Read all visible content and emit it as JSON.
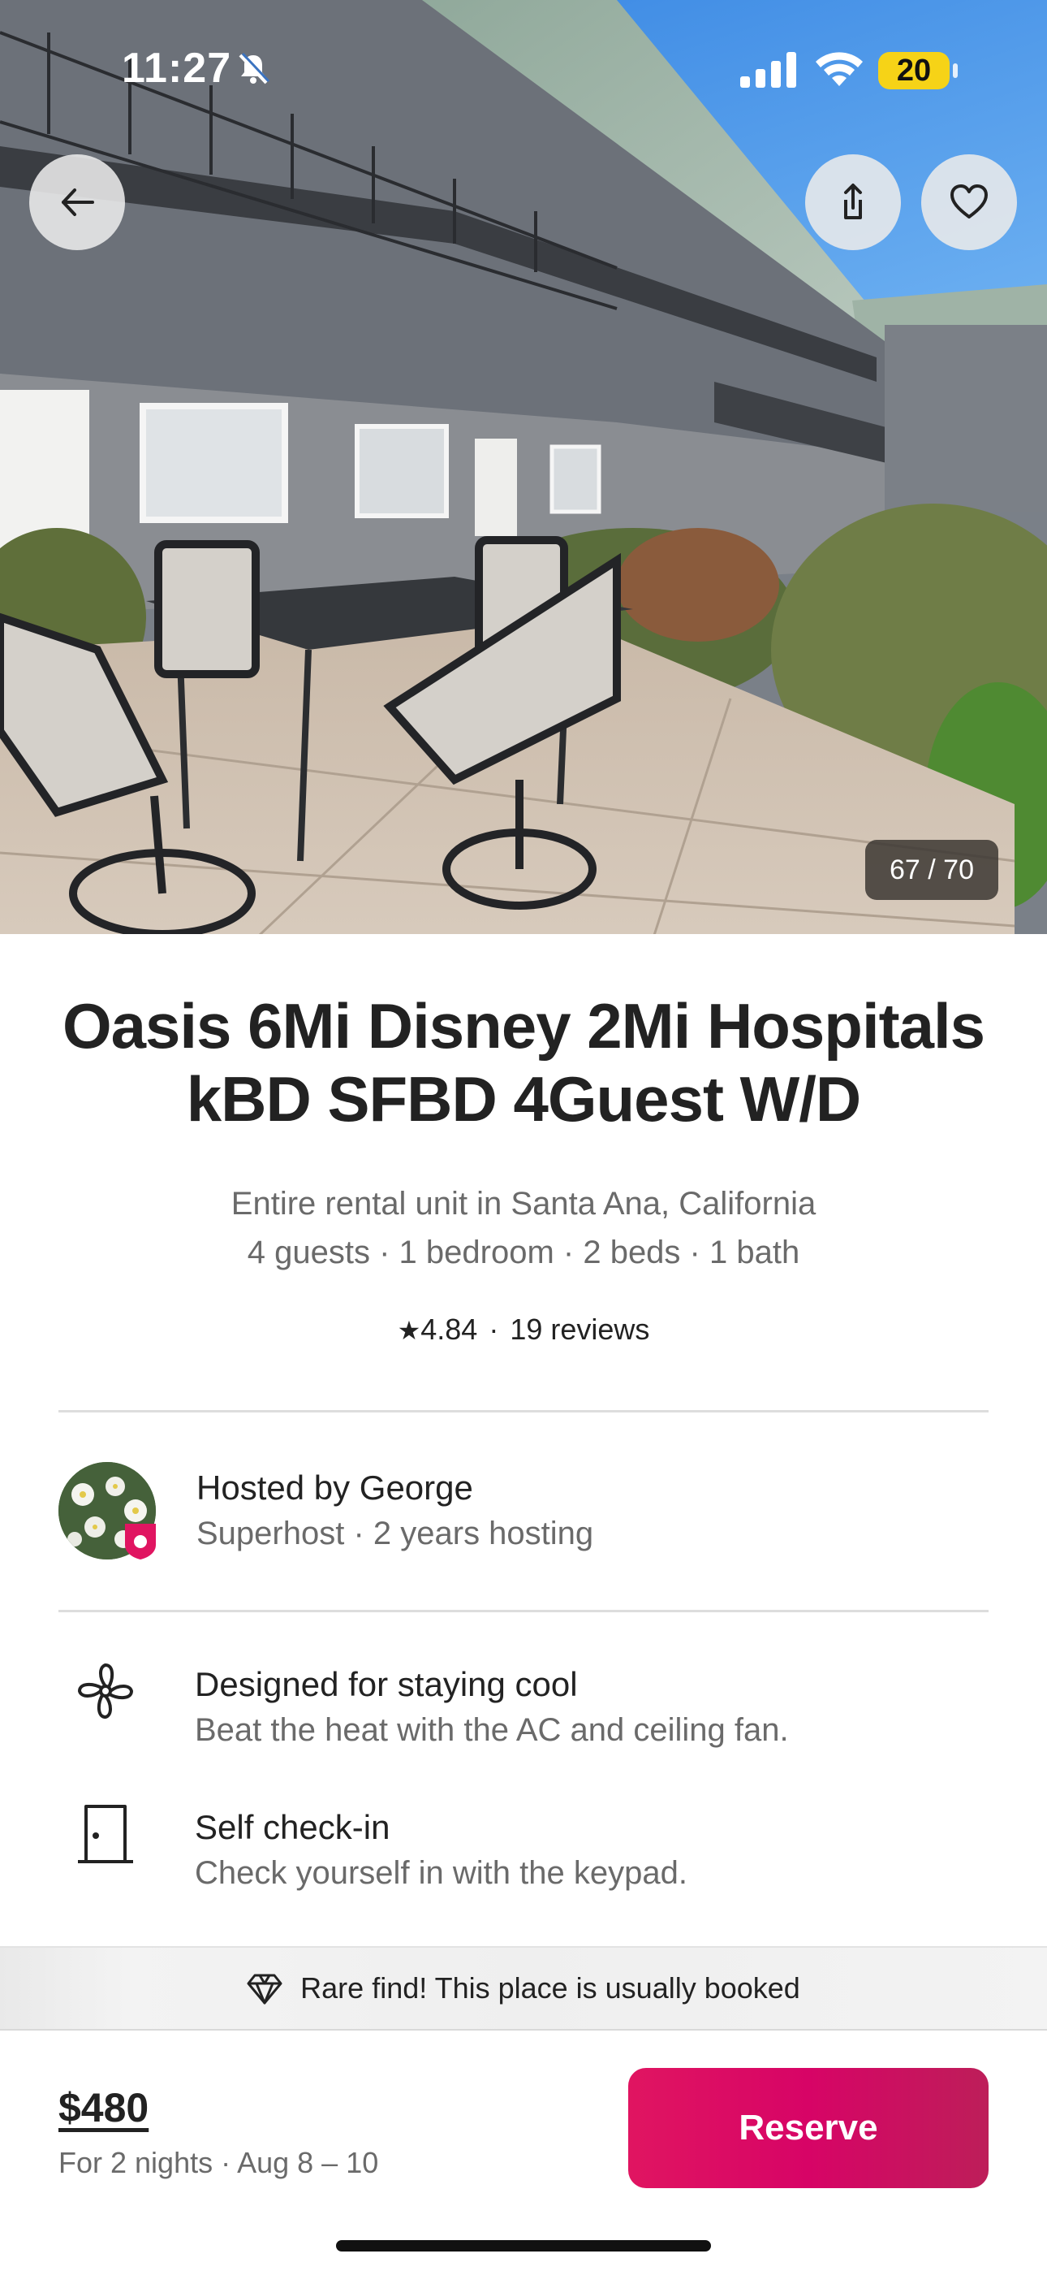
{
  "status_bar": {
    "time": "11:27",
    "battery": "20",
    "icons": [
      "bell-slash-icon",
      "cellular-signal-icon",
      "wifi-icon",
      "battery-icon"
    ],
    "battery_color": "#f6d317"
  },
  "hero": {
    "photo_counter": "67 / 70",
    "buttons": [
      "back-arrow-icon",
      "share-icon",
      "heart-icon"
    ]
  },
  "listing": {
    "title_line1": "Oasis 6Mi Disney 2Mi Hospitals",
    "title_line2": "kBD SFBD 4Guest W/D",
    "type_location": "Entire rental unit in Santa Ana, California",
    "details": "4 guests · 1 bedroom · 2 beds · 1 bath",
    "rating": "4.84",
    "separator": "·",
    "reviews": "19 reviews"
  },
  "host": {
    "name": "Hosted by George",
    "sub": "Superhost · 2 years hosting"
  },
  "features": [
    {
      "icon": "fan-icon",
      "title": "Designed for staying cool",
      "desc": "Beat the heat with the AC and ceiling fan."
    },
    {
      "icon": "door-icon",
      "title": "Self check-in",
      "desc": "Check yourself in with the keypad."
    }
  ],
  "banner": {
    "icon": "diamond-icon",
    "text": "Rare find! This place is usually booked"
  },
  "booking": {
    "price": "$480",
    "sub": "For 2 nights · Aug 8 – 10",
    "reserve_label": "Reserve"
  },
  "colors": {
    "accent": "#e01561",
    "text": "#222222",
    "muted": "#6a6a6a"
  }
}
